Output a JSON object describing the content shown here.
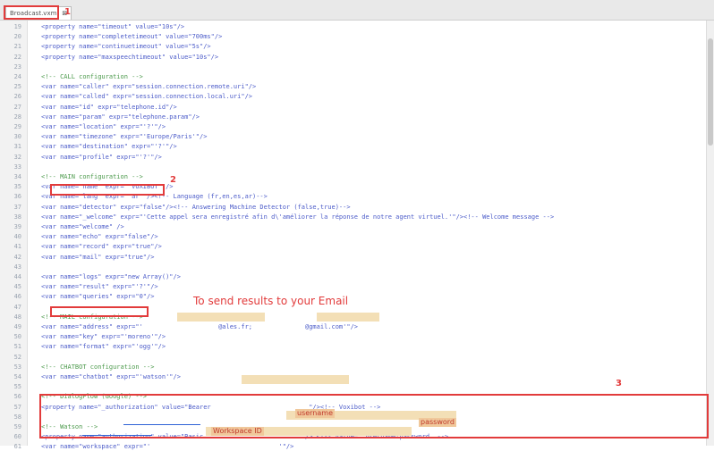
{
  "tab": {
    "label": "Broadcast.vxml",
    "close": "⊠"
  },
  "lines": [
    {
      "n": "19",
      "t": "<property name=\"timeout\" value=\"10s\"/>",
      "cls": "code"
    },
    {
      "n": "20",
      "t": "<property name=\"completetimeout\" value=\"700ms\"/>",
      "cls": "code"
    },
    {
      "n": "21",
      "t": "<property name=\"continuetimeout\" value=\"5s\"/>",
      "cls": "code"
    },
    {
      "n": "22",
      "t": "<property name=\"maxspeechtimeout\" value=\"10s\"/>",
      "cls": "code"
    },
    {
      "n": "23",
      "t": "",
      "cls": "code"
    },
    {
      "n": "24",
      "t": "<!-- CALL configuration -->",
      "cls": "cm"
    },
    {
      "n": "25",
      "t": "<var name=\"caller\" expr=\"session.connection.remote.uri\"/>",
      "cls": "code"
    },
    {
      "n": "26",
      "t": "<var name=\"called\" expr=\"session.connection.local.uri\"/>",
      "cls": "code"
    },
    {
      "n": "27",
      "t": "<var name=\"id\" expr=\"telephone.id\"/>",
      "cls": "code"
    },
    {
      "n": "28",
      "t": "<var name=\"param\" expr=\"telephone.param\"/>",
      "cls": "code"
    },
    {
      "n": "29",
      "t": "<var name=\"location\" expr=\"'?'\"/>",
      "cls": "code"
    },
    {
      "n": "30",
      "t": "<var name=\"timezone\" expr=\"'Europe/Paris'\"/>",
      "cls": "code"
    },
    {
      "n": "31",
      "t": "<var name=\"destination\" expr=\"'?'\"/>",
      "cls": "code"
    },
    {
      "n": "32",
      "t": "<var name=\"profile\" expr=\"'?'\"/>",
      "cls": "code"
    },
    {
      "n": "33",
      "t": "",
      "cls": "code"
    },
    {
      "n": "34",
      "t": "<!-- MAIN configuration -->",
      "cls": "cm"
    },
    {
      "n": "35",
      "t": "<var name=\"name\" expr=\"'VOXIBOT'\"/>",
      "cls": "code"
    },
    {
      "n": "36",
      "t": "<var name=\"lang\" expr=\"'ar'\"/><!-- Language (fr,en,es,ar)-->",
      "cls": "code"
    },
    {
      "n": "37",
      "t": "<var name=\"detector\" expr=\"false\"/><!-- Answering Machine Detector (false,true)-->",
      "cls": "code"
    },
    {
      "n": "38",
      "t": "<var name=\"_welcome\" expr=\"'Cette appel sera enregistré afin d\\'améliorer la réponse de notre agent virtuel.'\"/><!-- Welcome message -->",
      "cls": "code"
    },
    {
      "n": "39",
      "t": "<var name=\"welcome\" />",
      "cls": "code"
    },
    {
      "n": "40",
      "t": "<var name=\"echo\" expr=\"false\"/>",
      "cls": "code"
    },
    {
      "n": "41",
      "t": "<var name=\"record\" expr=\"true\"/>",
      "cls": "code"
    },
    {
      "n": "42",
      "t": "<var name=\"mail\" expr=\"true\"/>",
      "cls": "code"
    },
    {
      "n": "43",
      "t": "",
      "cls": "code"
    },
    {
      "n": "44",
      "t": "<var name=\"logs\" expr=\"new Array()\"/>",
      "cls": "code"
    },
    {
      "n": "45",
      "t": "<var name=\"result\" expr=\"'?'\"/>",
      "cls": "code"
    },
    {
      "n": "46",
      "t": "<var name=\"queries\" expr=\"0\"/>",
      "cls": "code"
    },
    {
      "n": "47",
      "t": "",
      "cls": "code"
    },
    {
      "n": "48",
      "t": "<!-- MAIL configuration -->",
      "cls": "cm"
    },
    {
      "n": "49",
      "t": "<var name=\"address\" expr=\"'                    @ales.fr;              @gmail.com'\"/>",
      "cls": "code"
    },
    {
      "n": "50",
      "t": "<var name=\"key\" expr=\"'moreno'\"/>",
      "cls": "code"
    },
    {
      "n": "51",
      "t": "<var name=\"format\" expr=\"'ogg'\"/>",
      "cls": "code"
    },
    {
      "n": "52",
      "t": "",
      "cls": "code"
    },
    {
      "n": "53",
      "t": "<!-- CHATBOT configuration -->",
      "cls": "cm"
    },
    {
      "n": "54",
      "t": "<var name=\"chatbot\" expr=\"'watson'\"/>",
      "cls": "code"
    },
    {
      "n": "55",
      "t": "",
      "cls": "code"
    },
    {
      "n": "56",
      "t": "<!-- DialogFlow (Google) -->",
      "cls": "cm"
    },
    {
      "n": "57",
      "t": "<property name=\"_authorization\" value=\"Bearer                          \"/><!-- Voxibot -->",
      "cls": "code"
    },
    {
      "n": "58",
      "t": "",
      "cls": "code"
    },
    {
      "n": "59",
      "t": "<!-- Watson -->",
      "cls": "cm"
    },
    {
      "n": "60",
      "t": "<property name=\"authorization\" value=\"Basic                          \"/> <!-- value=\" username:password  -->",
      "cls": "code"
    },
    {
      "n": "61",
      "t": "<var name=\"workspace\" expr=\"'                                  '\"/>",
      "cls": "code"
    }
  ],
  "annotations": {
    "n1": "1",
    "n2": "2",
    "n3": "3",
    "email_note": "To send  results to your Email",
    "username": "username",
    "password": "password",
    "workspace_id": "Workspace ID"
  }
}
